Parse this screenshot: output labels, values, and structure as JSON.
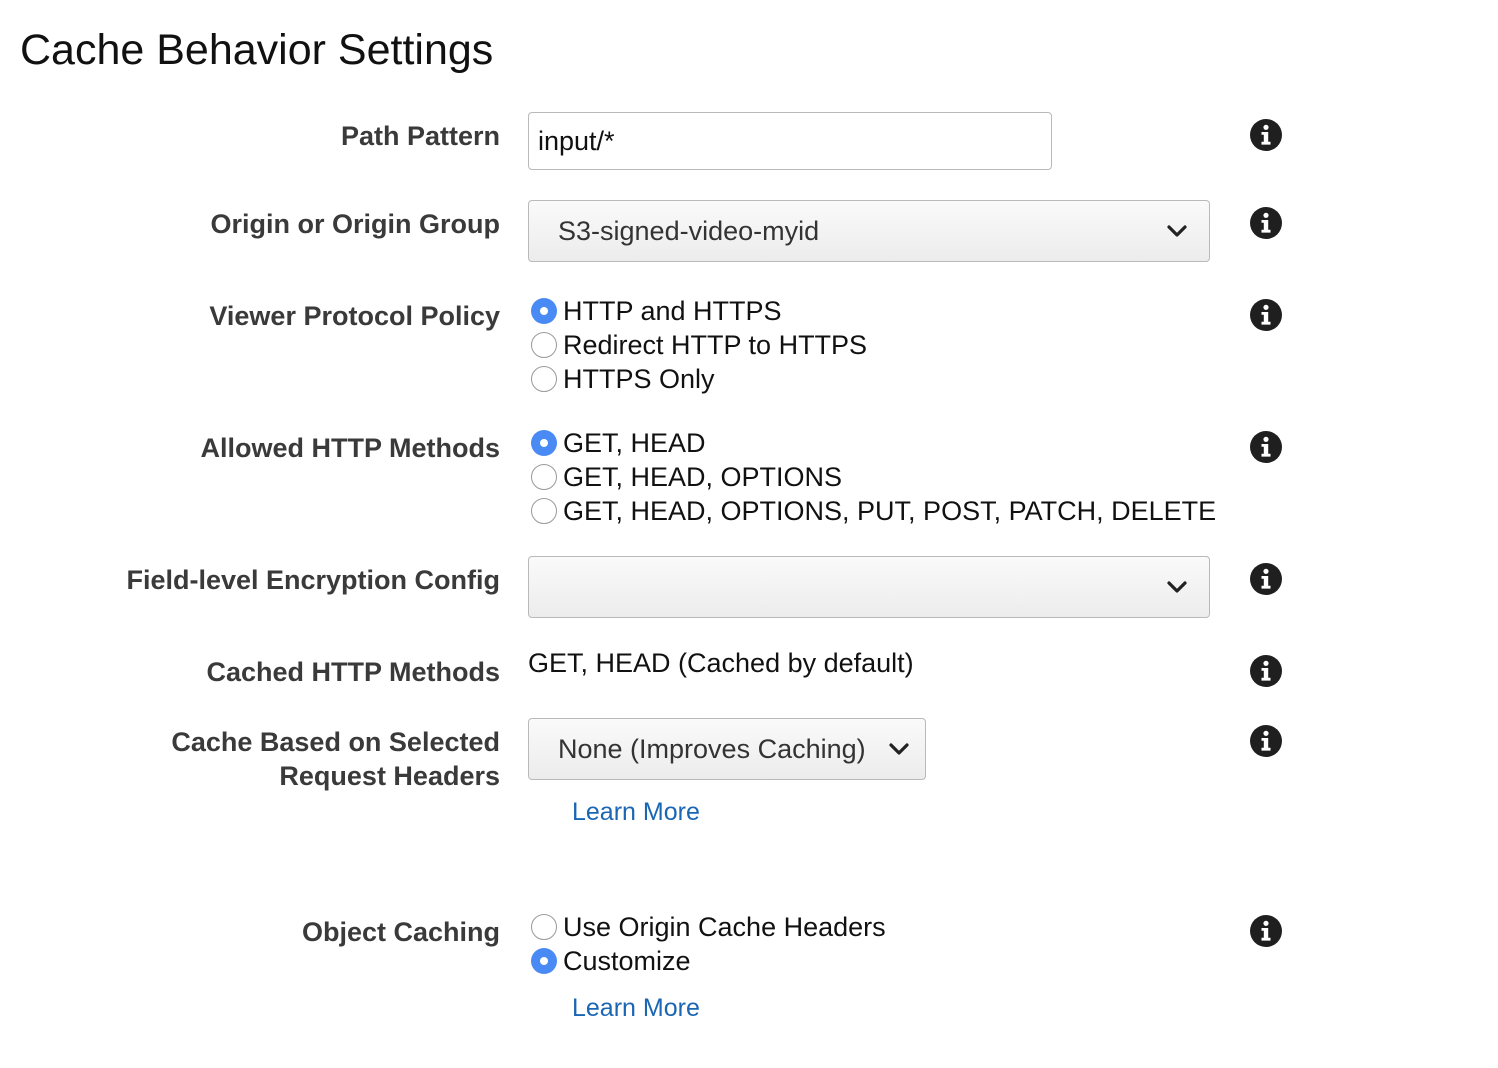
{
  "page": {
    "title": "Cache Behavior Settings"
  },
  "path_pattern": {
    "label": "Path Pattern",
    "value": "input/*"
  },
  "origin": {
    "label": "Origin or Origin Group",
    "selected": "S3-signed-video-myid"
  },
  "viewer_protocol": {
    "label": "Viewer Protocol Policy",
    "options": [
      "HTTP and HTTPS",
      "Redirect HTTP to HTTPS",
      "HTTPS Only"
    ],
    "selected_index": 0
  },
  "allowed_methods": {
    "label": "Allowed HTTP Methods",
    "options": [
      "GET, HEAD",
      "GET, HEAD, OPTIONS",
      "GET, HEAD, OPTIONS, PUT, POST, PATCH, DELETE"
    ],
    "selected_index": 0
  },
  "field_encryption": {
    "label": "Field-level Encryption Config",
    "selected": ""
  },
  "cached_methods": {
    "label": "Cached HTTP Methods",
    "value": "GET, HEAD (Cached by default)"
  },
  "cache_headers": {
    "label_line1": "Cache Based on Selected",
    "label_line2": "Request Headers",
    "selected": "None (Improves Caching)",
    "learn_more": "Learn More"
  },
  "object_caching": {
    "label": "Object Caching",
    "options": [
      "Use Origin Cache Headers",
      "Customize"
    ],
    "selected_index": 1,
    "learn_more": "Learn More"
  },
  "icons": {
    "info": "info-icon",
    "dropdown": "chevron-down-icon"
  },
  "colors": {
    "accent": "#4a8af4",
    "link": "#1a66b3",
    "label": "#3a3a3a"
  }
}
